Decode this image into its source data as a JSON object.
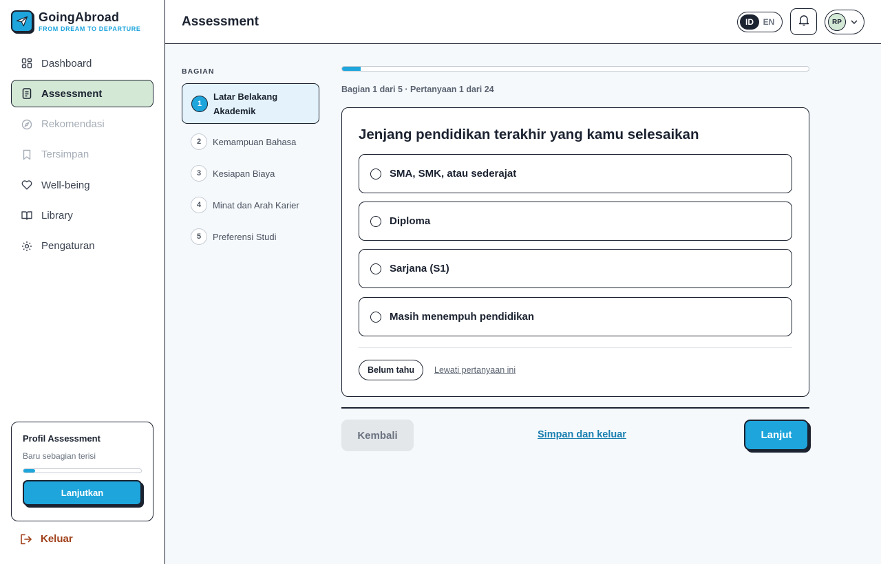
{
  "brand": {
    "name": "GoingAbroad",
    "tagline": "FROM DREAM TO DEPARTURE",
    "logo_icon": "paper-plane-icon"
  },
  "colors": {
    "accent": "#1ea5dc",
    "ink": "#1b2230",
    "active_nav_bg": "#d4e8d6",
    "logout": "#a0401a"
  },
  "sidebar": {
    "items": [
      {
        "label": "Dashboard",
        "icon": "grid-icon",
        "state": "normal"
      },
      {
        "label": "Assessment",
        "icon": "document-icon",
        "state": "active"
      },
      {
        "label": "Rekomendasi",
        "icon": "compass-icon",
        "state": "disabled"
      },
      {
        "label": "Tersimpan",
        "icon": "bookmark-icon",
        "state": "disabled"
      },
      {
        "label": "Well-being",
        "icon": "heart-icon",
        "state": "normal"
      },
      {
        "label": "Library",
        "icon": "book-icon",
        "state": "normal"
      },
      {
        "label": "Pengaturan",
        "icon": "gear-icon",
        "state": "normal"
      }
    ],
    "profile_card": {
      "title": "Profil Assessment",
      "status": "Baru sebagian terisi",
      "progress_fraction": 0.1,
      "button_label": "Lanjutkan"
    },
    "logout_label": "Keluar"
  },
  "header": {
    "title": "Assessment",
    "lang_options": [
      "ID",
      "EN"
    ],
    "lang_selected": "ID",
    "avatar_initials": "RP"
  },
  "sections": {
    "label": "BAGIAN",
    "items": [
      {
        "num": "1",
        "label": "Latar Belakang Akademik",
        "active": true
      },
      {
        "num": "2",
        "label": "Kemampuan Bahasa",
        "active": false
      },
      {
        "num": "3",
        "label": "Kesiapan Biaya",
        "active": false
      },
      {
        "num": "4",
        "label": "Minat dan Arah Karier",
        "active": false
      },
      {
        "num": "5",
        "label": "Preferensi Studi",
        "active": false
      }
    ]
  },
  "progress": {
    "fraction": 0.04,
    "text": "Bagian 1 dari 5 · Pertanyaan 1 dari 24"
  },
  "question": {
    "title": "Jenjang pendidikan terakhir yang kamu selesaikan",
    "options": [
      "SMA, SMK, atau sederajat",
      "Diploma",
      "Sarjana (S1)",
      "Masih menempuh pendidikan"
    ],
    "unsure_label": "Belum tahu",
    "skip_label": "Lewati pertanyaan ini"
  },
  "footer": {
    "back_label": "Kembali",
    "save_exit_label": "Simpan dan keluar",
    "next_label": "Lanjut"
  }
}
